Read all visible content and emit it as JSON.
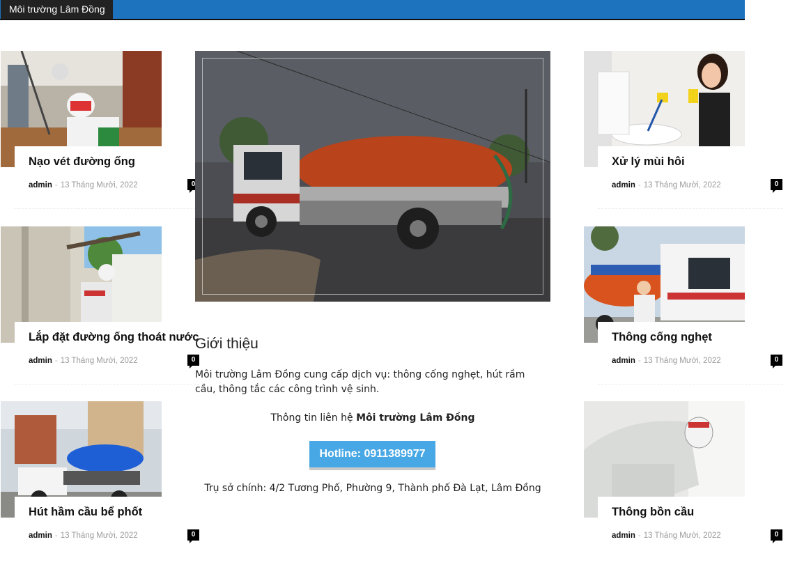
{
  "header": {
    "brand": "Môi trường Lâm Đồng"
  },
  "posts": [
    {
      "title": "Nạo vét đường ống",
      "author": "admin",
      "date": "13 Tháng Mười, 2022",
      "comments": "0"
    },
    {
      "title": "Lắp đặt đường ống thoát nước",
      "author": "admin",
      "date": "13 Tháng Mười, 2022",
      "comments": "0"
    },
    {
      "title": "Hút hầm cầu bể phốt",
      "author": "admin",
      "date": "13 Tháng Mười, 2022",
      "comments": "0"
    },
    {
      "title": "Xử lý mùi hôi",
      "author": "admin",
      "date": "13 Tháng Mười, 2022",
      "comments": "0"
    },
    {
      "title": "Thông cống nghẹt",
      "author": "admin",
      "date": "13 Tháng Mười, 2022",
      "comments": "0"
    },
    {
      "title": "Thông bồn cầu",
      "author": "admin",
      "date": "13 Tháng Mười, 2022",
      "comments": "0"
    }
  ],
  "intro": {
    "heading": "Giới thiệu",
    "body": "Môi trường Lâm Đồng cung cấp dịch vụ: thông cống nghẹt, hút rầm cầu, thông tắc các công trình vệ sinh.",
    "contact_prefix": "Thông tin liên hệ",
    "contact_name": "Môi trường Lâm Đồng",
    "hotline": "Hotline: 0911389977",
    "address": "Trụ sở chính: 4/2 Tương Phố, Phường 9, Thành phố Đà Lạt, Lâm Đồng"
  },
  "colors": {
    "header_bar": "#1e73be",
    "brand_bg": "#222222",
    "hotline_bg": "#47a8e5",
    "truck_tank": "#d9531e"
  }
}
